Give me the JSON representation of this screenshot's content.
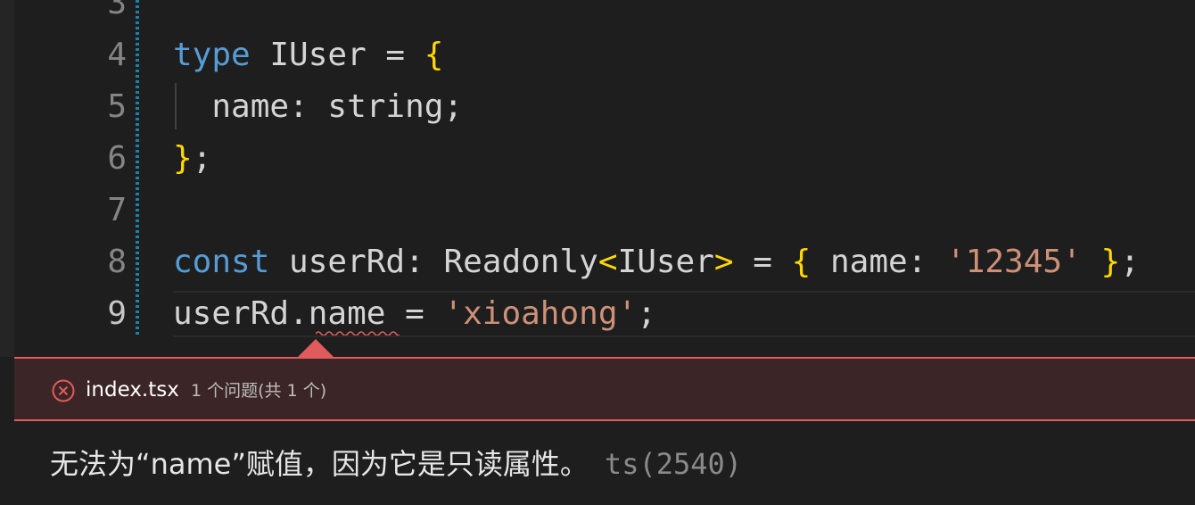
{
  "editor": {
    "lines": [
      {
        "number": "3",
        "tokens": []
      },
      {
        "number": "4",
        "tokens": [
          {
            "text": "type",
            "cls": "kw"
          },
          {
            "text": " IUser = ",
            "cls": "tx"
          },
          {
            "text": "{",
            "cls": "br"
          }
        ]
      },
      {
        "number": "5",
        "tokens": [
          {
            "text": "  name: string;",
            "cls": "tx"
          }
        ]
      },
      {
        "number": "6",
        "tokens": [
          {
            "text": "}",
            "cls": "br"
          },
          {
            "text": ";",
            "cls": "tx"
          }
        ]
      },
      {
        "number": "7",
        "tokens": []
      },
      {
        "number": "8",
        "tokens": [
          {
            "text": "const",
            "cls": "kw"
          },
          {
            "text": " userRd: Readonly",
            "cls": "tx"
          },
          {
            "text": "<",
            "cls": "gen"
          },
          {
            "text": "IUser",
            "cls": "tx"
          },
          {
            "text": ">",
            "cls": "gen"
          },
          {
            "text": " = ",
            "cls": "tx"
          },
          {
            "text": "{",
            "cls": "br"
          },
          {
            "text": " name: ",
            "cls": "tx"
          },
          {
            "text": "'12345'",
            "cls": "st"
          },
          {
            "text": " ",
            "cls": "tx"
          },
          {
            "text": "}",
            "cls": "br"
          },
          {
            "text": ";",
            "cls": "tx"
          }
        ]
      },
      {
        "number": "9",
        "tokens": [
          {
            "text": "userRd.name = ",
            "cls": "tx"
          },
          {
            "text": "'xioahong'",
            "cls": "st"
          },
          {
            "text": ";",
            "cls": "tx"
          }
        ]
      }
    ]
  },
  "problems": {
    "filename": "index.tsx",
    "count_label": "1 个问题(共 1 个)",
    "message": "无法为“name”赋值，因为它是只读属性。",
    "code": "ts(2540)"
  },
  "colors": {
    "error": "#e05b5b",
    "keyword": "#569cd6",
    "string": "#ce9178",
    "bracket": "#ffd700"
  }
}
